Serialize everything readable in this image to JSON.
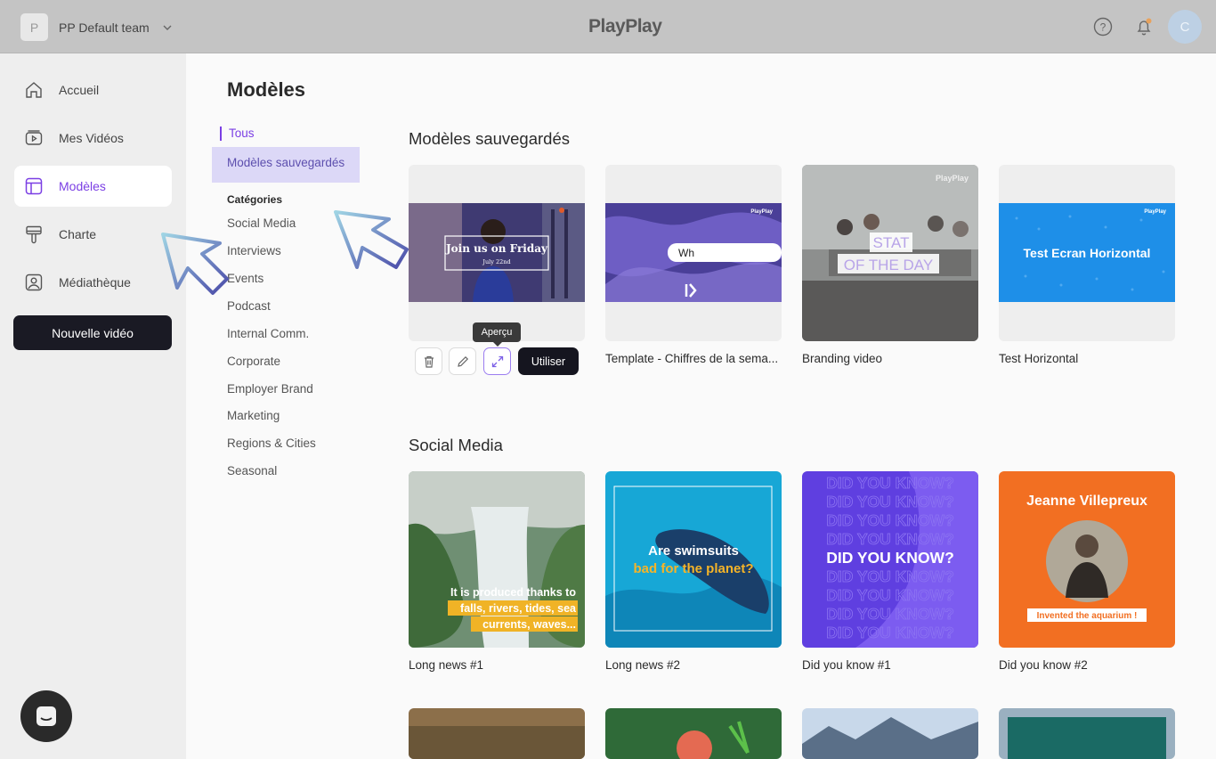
{
  "topbar": {
    "team_initial": "P",
    "team_name": "PP Default team",
    "logo": "PlayPlay",
    "avatar_initial": "C",
    "notification_dot_color": "#e8a25c"
  },
  "sidebar": {
    "items": [
      {
        "label": "Accueil",
        "icon": "home-icon"
      },
      {
        "label": "Mes Vidéos",
        "icon": "video-icon"
      },
      {
        "label": "Modèles",
        "icon": "template-icon"
      },
      {
        "label": "Charte",
        "icon": "brush-icon"
      },
      {
        "label": "Médiathèque",
        "icon": "media-library-icon"
      }
    ],
    "active": "Modèles",
    "new_video_label": "Nouvelle vidéo"
  },
  "main": {
    "title": "Modèles",
    "filters": {
      "all": "Tous",
      "saved": "Modèles sauvegardés",
      "categories_heading": "Catégories",
      "categories": [
        "Social Media",
        "Interviews",
        "Events",
        "Podcast",
        "Internal Comm.",
        "Corporate",
        "Employer Brand",
        "Marketing",
        "Regions & Cities",
        "Seasonal"
      ]
    },
    "saved_section": {
      "title": "Modèles sauvegardés",
      "cards": [
        {
          "label": "",
          "thumb_text": "Join us on Friday",
          "thumb_subtext": "July 22nd"
        },
        {
          "label": "Template - Chiffres de la sema...",
          "thumb_text": "Wh",
          "thumb_brand": "PlayPlay"
        },
        {
          "label": "Branding video",
          "thumb_text_1": "STAT",
          "thumb_text_2": "OF THE DAY",
          "thumb_brand": "PlayPlay"
        },
        {
          "label": "Test Horizontal",
          "thumb_text": "Test Ecran Horizontal",
          "thumb_brand": "PlayPlay"
        }
      ],
      "tooltip": "Aperçu",
      "use_label": "Utiliser"
    },
    "social_section": {
      "title": "Social Media",
      "cards": [
        {
          "label": "Long news #1",
          "thumb_line_1": "It is produced thanks to",
          "thumb_line_2": "falls, rivers, tides, sea",
          "thumb_line_3": "currents, waves..."
        },
        {
          "label": "Long news #2",
          "thumb_line_1": "Are swimsuits",
          "thumb_line_2": "bad for the planet?"
        },
        {
          "label": "Did you know #1",
          "thumb_text": "DID YOU KNOW?"
        },
        {
          "label": "Did you know #2",
          "thumb_title": "Jeanne Villepreux",
          "thumb_caption": "Invented the aquarium !"
        }
      ]
    }
  }
}
